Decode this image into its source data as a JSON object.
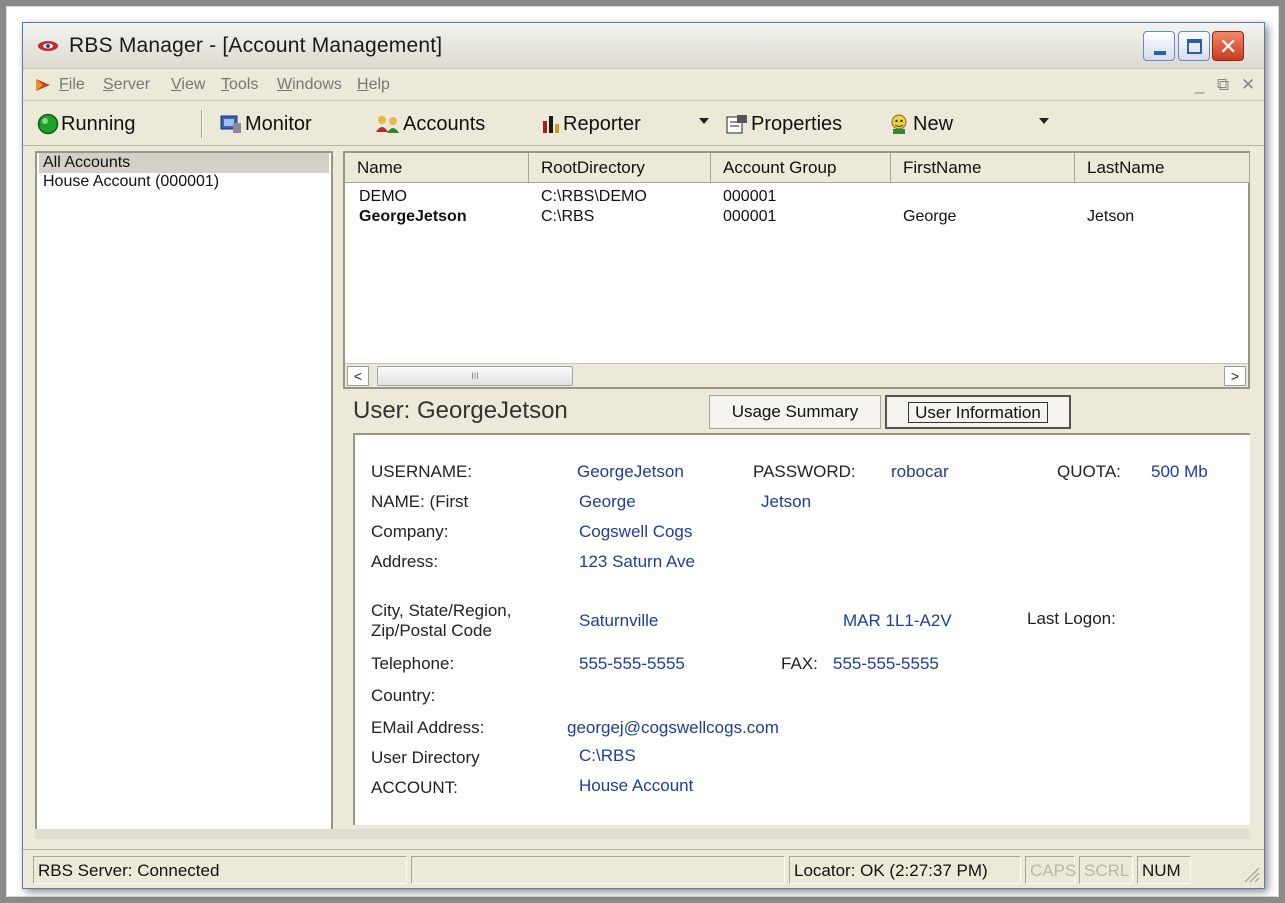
{
  "window": {
    "title": "RBS Manager - [Account Management]",
    "controls": {
      "minimize": "_",
      "maximize": "□",
      "close": "✕"
    }
  },
  "menu": {
    "items": [
      "File",
      "Server",
      "View",
      "Tools",
      "Windows",
      "Help"
    ],
    "mdi_controls": [
      "_",
      "⧉",
      "✕"
    ]
  },
  "toolbar": {
    "running": "Running",
    "monitor": "Monitor",
    "accounts": "Accounts",
    "reporter": "Reporter",
    "properties": "Properties",
    "new": "New"
  },
  "tree": {
    "items": [
      {
        "label": "All Accounts",
        "selected": true
      },
      {
        "label": "House Account (000001)",
        "selected": false
      }
    ]
  },
  "accounts_list": {
    "columns": [
      "Name",
      "RootDirectory",
      "Account Group",
      "FirstName",
      "LastName"
    ],
    "rows": [
      {
        "name": "DEMO",
        "root": "C:\\RBS\\DEMO",
        "group": "000001",
        "first": "",
        "last": ""
      },
      {
        "name": "GeorgeJetson",
        "root": "C:\\RBS",
        "group": "000001",
        "first": "George",
        "last": "Jetson"
      }
    ],
    "scroll_left": "<",
    "scroll_right": ">",
    "thumb_grip": "III"
  },
  "detail": {
    "title": "User: GeorgeJetson",
    "tabs": [
      "Usage Summary",
      "User Information"
    ],
    "active_tab": "User Information",
    "labels": {
      "username": "USERNAME:",
      "name": "NAME: (First",
      "company": "Company:",
      "address": "Address:",
      "city_line1": "City, State/Region,",
      "city_line2": "Zip/Postal Code",
      "telephone": "Telephone:",
      "country": "Country:",
      "email": "EMail Address:",
      "user_directory": "User Directory",
      "account": "ACCOUNT:",
      "password": "PASSWORD:",
      "quota": "QUOTA:",
      "fax": "FAX:",
      "last_logon": "Last Logon:"
    },
    "values": {
      "username": "GeorgeJetson",
      "first_name": "George",
      "last_name": "Jetson",
      "company": "Cogswell Cogs",
      "address": "123 Saturn Ave",
      "city": "Saturnville",
      "zip": "MAR 1L1-A2V",
      "telephone": "555-555-5555",
      "fax": "555-555-5555",
      "email": "georgej@cogswellcogs.com",
      "user_directory": "C:\\RBS",
      "account": "House Account",
      "password": "robocar",
      "quota": "500 Mb"
    }
  },
  "status": {
    "server": "RBS Server: Connected",
    "locator": "Locator: OK (2:27:37 PM)",
    "caps": "CAPS",
    "scrl": "SCRL",
    "num": "NUM"
  },
  "colors": {
    "value_text": "#1d3d9c",
    "running_indicator": "#1fa02a",
    "close_button": "#d4482a"
  },
  "icons": [
    "app-logo-icon",
    "menu-arrow-icon",
    "running-status-icon",
    "monitor-icon",
    "accounts-icon",
    "reporter-icon",
    "properties-icon",
    "new-user-icon"
  ]
}
